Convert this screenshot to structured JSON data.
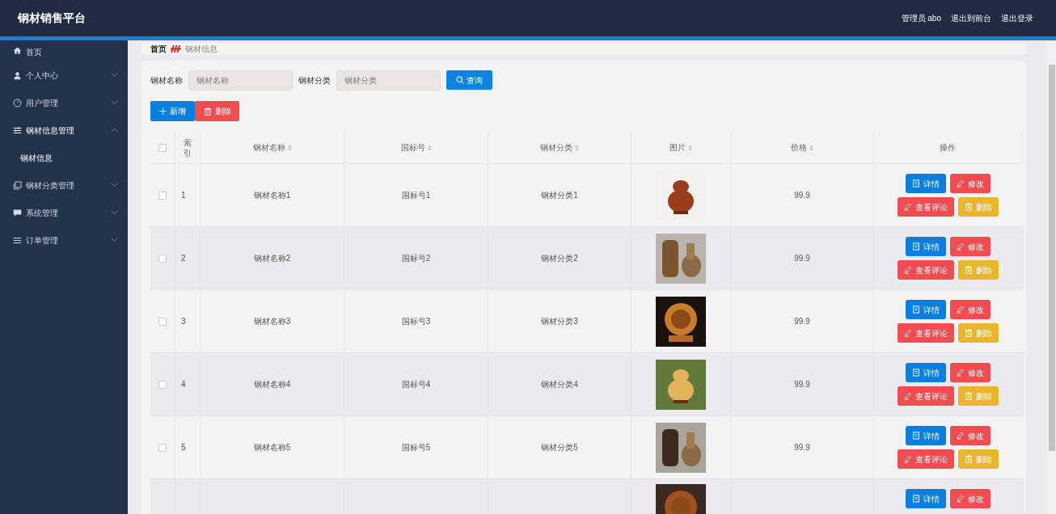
{
  "header": {
    "title": "钢材销售平台",
    "links": [
      "管理员 abo",
      "退出到前台",
      "退出登录"
    ]
  },
  "sidebar": {
    "items": [
      {
        "label": "首页"
      },
      {
        "label": "个人中心",
        "expanded": false
      },
      {
        "label": "用户管理",
        "expanded": false
      },
      {
        "label": "钢材信息管理",
        "expanded": true,
        "children": [
          {
            "label": "钢材信息"
          }
        ]
      },
      {
        "label": "钢材分类管理",
        "expanded": false
      },
      {
        "label": "系统管理",
        "expanded": false
      },
      {
        "label": "订单管理",
        "expanded": false
      }
    ]
  },
  "breadcrumb": [
    "首页",
    "钢材信息"
  ],
  "search": {
    "fields": [
      {
        "label": "钢材名称",
        "placeholder": "钢材名称"
      },
      {
        "label": "钢材分类",
        "placeholder": "钢材分类"
      }
    ],
    "button": "查询"
  },
  "toolbar": [
    {
      "label": "新增",
      "kind": "add"
    },
    {
      "label": "删除",
      "kind": "delete"
    }
  ],
  "table": {
    "all_checked": false,
    "columns": [
      {
        "label": "索引",
        "sortable": false
      },
      {
        "label": "钢材名称",
        "sortable": true
      },
      {
        "label": "国标号",
        "sortable": true
      },
      {
        "label": "钢材分类",
        "sortable": true
      },
      {
        "label": "图片",
        "sortable": true
      },
      {
        "label": "价格",
        "sortable": true
      },
      {
        "label": "操作",
        "sortable": false
      }
    ],
    "rows": [
      {
        "checked": false,
        "index": "1",
        "name": "钢材名称1",
        "code": "国标号1",
        "category": "钢材分类1",
        "price": "99.9",
        "actions": [
          {
            "label": "详情",
            "kind": "detail"
          },
          {
            "label": "修改",
            "kind": "edit"
          },
          {
            "label": "查看评论",
            "kind": "comment"
          },
          {
            "label": "删除",
            "kind": "delete"
          }
        ]
      },
      {
        "checked": false,
        "index": "2",
        "name": "钢材名称2",
        "code": "国标号2",
        "category": "钢材分类2",
        "price": "99.9",
        "actions": [
          {
            "label": "详情",
            "kind": "detail"
          },
          {
            "label": "修改",
            "kind": "edit"
          },
          {
            "label": "查看评论",
            "kind": "comment"
          },
          {
            "label": "删除",
            "kind": "delete"
          }
        ]
      },
      {
        "checked": false,
        "index": "3",
        "name": "钢材名称3",
        "code": "国标号3",
        "category": "钢材分类3",
        "price": "99.9",
        "actions": [
          {
            "label": "详情",
            "kind": "detail"
          },
          {
            "label": "修改",
            "kind": "edit"
          },
          {
            "label": "查看评论",
            "kind": "comment"
          },
          {
            "label": "删除",
            "kind": "delete"
          }
        ]
      },
      {
        "checked": false,
        "index": "4",
        "name": "钢材名称4",
        "code": "国标号4",
        "category": "钢材分类4",
        "price": "99.9",
        "actions": [
          {
            "label": "详情",
            "kind": "detail"
          },
          {
            "label": "修改",
            "kind": "edit"
          },
          {
            "label": "查看评论",
            "kind": "comment"
          },
          {
            "label": "删除",
            "kind": "delete"
          }
        ]
      },
      {
        "checked": false,
        "index": "5",
        "name": "钢材名称5",
        "code": "国标号5",
        "category": "钢材分类5",
        "price": "99.9",
        "actions": [
          {
            "label": "详情",
            "kind": "detail"
          },
          {
            "label": "修改",
            "kind": "edit"
          },
          {
            "label": "查看评论",
            "kind": "comment"
          },
          {
            "label": "删除",
            "kind": "delete"
          }
        ]
      }
    ],
    "partial_row": {
      "actions": [
        {
          "label": "详情",
          "kind": "detail"
        },
        {
          "label": "修改",
          "kind": "edit"
        }
      ]
    }
  }
}
